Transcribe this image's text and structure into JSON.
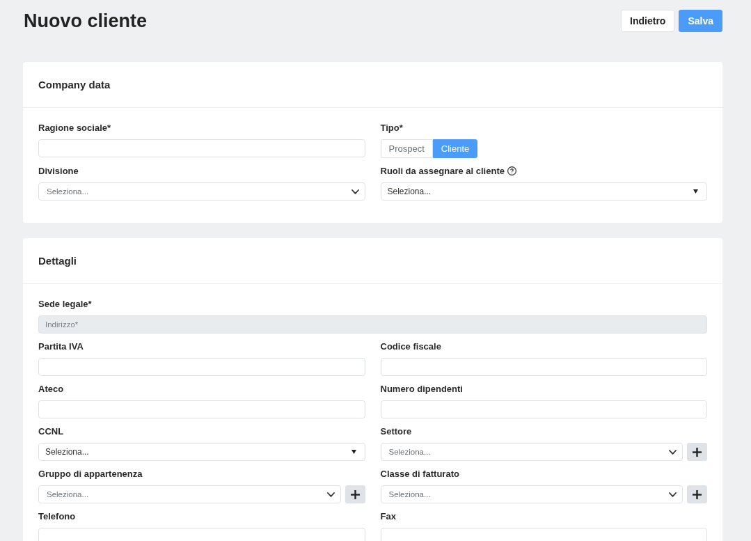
{
  "header": {
    "title": "Nuovo cliente",
    "buttons": [
      {
        "label": "Indietro",
        "kind": "secondary"
      },
      {
        "label": "Salva",
        "kind": "primary"
      }
    ]
  },
  "sections": [
    {
      "title": "Company data",
      "rows": [
        {
          "fields": [
            {
              "kind": "text",
              "label": "Ragione sociale*",
              "disabled": false
            },
            {
              "kind": "toggle",
              "label": "Tipo*",
              "options": [
                {
                  "label": "Prospect",
                  "selected": false
                },
                {
                  "label": "Cliente",
                  "selected": true
                }
              ]
            }
          ]
        },
        {
          "fields": [
            {
              "kind": "select",
              "label": "Divisione",
              "placeholder": "Seleziona...",
              "add_button": false,
              "help": false
            },
            {
              "kind": "combobox",
              "label": "Ruoli da assegnare al cliente",
              "placeholder": "Seleziona...",
              "add_button": false,
              "help": true
            }
          ]
        }
      ]
    },
    {
      "title": "Dettagli",
      "rows": [
        {
          "fields": [
            {
              "kind": "text",
              "label": "Sede legale*",
              "placeholder": "Indirizzo*",
              "disabled": true
            }
          ]
        },
        {
          "fields": [
            {
              "kind": "text",
              "label": "Partita IVA",
              "disabled": false
            },
            {
              "kind": "text",
              "label": "Codice fiscale",
              "disabled": false
            }
          ]
        },
        {
          "fields": [
            {
              "kind": "text",
              "label": "Ateco",
              "disabled": false
            },
            {
              "kind": "text",
              "label": "Numero dipendenti",
              "disabled": false
            }
          ]
        },
        {
          "fields": [
            {
              "kind": "combobox",
              "label": "CCNL",
              "placeholder": "Seleziona...",
              "add_button": false,
              "help": false
            },
            {
              "kind": "select",
              "label": "Settore",
              "placeholder": "Seleziona...",
              "add_button": true,
              "help": false
            }
          ]
        },
        {
          "fields": [
            {
              "kind": "select",
              "label": "Gruppo di appartenenza",
              "placeholder": "Seleziona...",
              "add_button": true,
              "help": false
            },
            {
              "kind": "select",
              "label": "Classe di fatturato",
              "placeholder": "Seleziona...",
              "add_button": true,
              "help": false
            }
          ]
        },
        {
          "fields": [
            {
              "kind": "text",
              "label": "Telefono",
              "disabled": false
            },
            {
              "kind": "text",
              "label": "Fax",
              "disabled": false
            }
          ]
        }
      ]
    }
  ]
}
